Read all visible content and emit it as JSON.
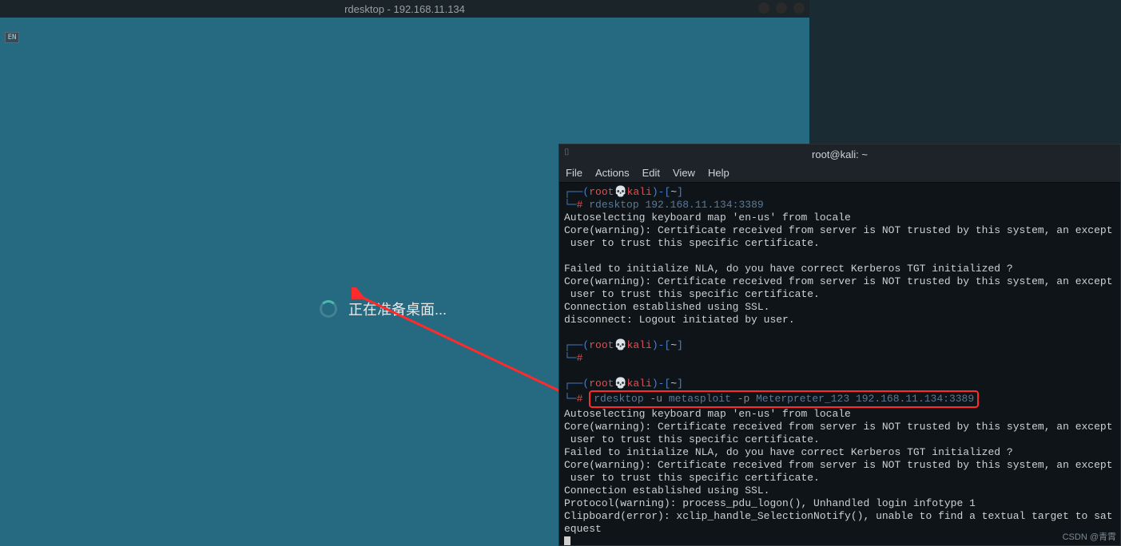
{
  "rdesktop": {
    "title": "rdesktop - 192.168.11.134",
    "lang": "EN",
    "message": "正在准备桌面..."
  },
  "terminal": {
    "title": "root@kali: ~",
    "menu": [
      "File",
      "Actions",
      "Edit",
      "View",
      "Help"
    ],
    "prompt": {
      "user": "root",
      "skull": "💀",
      "host": "kali",
      "path": "~",
      "hash": "#"
    },
    "cmd1": "rdesktop 192.168.11.134:3389",
    "out1_l1": "Autoselecting keyboard map 'en-us' from locale",
    "out1_l2": "Core(warning): Certificate received from server is NOT trusted by this system, an except",
    "out1_l3": " user to trust this specific certificate.",
    "out1_l4": "",
    "out1_l5": "Failed to initialize NLA, do you have correct Kerberos TGT initialized ?",
    "out1_l6": "Core(warning): Certificate received from server is NOT trusted by this system, an except",
    "out1_l7": " user to trust this specific certificate.",
    "out1_l8": "Connection established using SSL.",
    "out1_l9": "disconnect: Logout initiated by user.",
    "cmd2": "",
    "cmd3_pre": "rdesktop",
    "cmd3_flag_u": " -u ",
    "cmd3_user": "metasploit",
    "cmd3_flag_p": " -p ",
    "cmd3_rest": "Meterpreter_123 192.168.11.134:3389",
    "out2_l1": "Autoselecting keyboard map 'en-us' from locale",
    "out2_l2": "Core(warning): Certificate received from server is NOT trusted by this system, an except",
    "out2_l3": " user to trust this specific certificate.",
    "out2_l4": "Failed to initialize NLA, do you have correct Kerberos TGT initialized ?",
    "out2_l5": "Core(warning): Certificate received from server is NOT trusted by this system, an except",
    "out2_l6": " user to trust this specific certificate.",
    "out2_l7": "Connection established using SSL.",
    "out2_l8": "Protocol(warning): process_pdu_logon(), Unhandled login infotype 1",
    "out2_l9": "Clipboard(error): xclip_handle_SelectionNotify(), unable to find a textual target to sat",
    "out2_l10": "equest"
  },
  "watermark": "CSDN @青霄"
}
